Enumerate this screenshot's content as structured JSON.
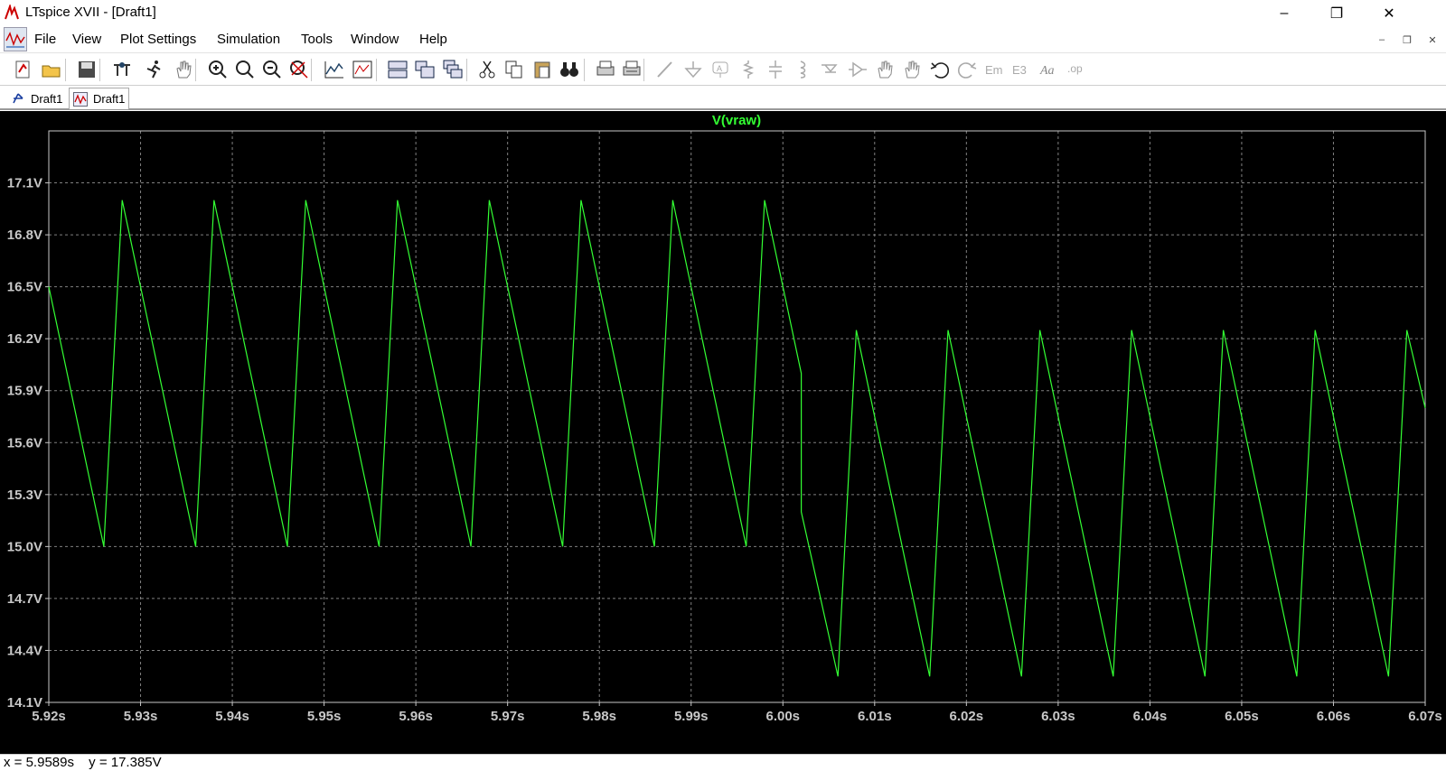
{
  "window": {
    "title": "LTspice XVII - [Draft1]",
    "minimize_glyph": "–",
    "maximize_glyph": "❐",
    "close_glyph": "✕"
  },
  "menu": {
    "items": [
      {
        "label": "File"
      },
      {
        "label": "View"
      },
      {
        "label": "Plot Settings"
      },
      {
        "label": "Simulation"
      },
      {
        "label": "Tools"
      },
      {
        "label": "Window"
      },
      {
        "label": "Help"
      }
    ],
    "mdi_minimize": "–",
    "mdi_restore": "❐",
    "mdi_close": "✕"
  },
  "toolbar": {
    "icons": [
      "new-schematic-icon",
      "open-icon",
      "save-icon",
      "control-panel-icon",
      "run-icon",
      "pan-hand-icon",
      "zoom-in-icon",
      "zoom-area-icon",
      "zoom-out-icon",
      "zoom-fit-icon",
      "autorange-icon",
      "annotate-icon",
      "tile-horizontal-icon",
      "tile-vertical-icon",
      "cascade-icon",
      "cut-icon",
      "copy-icon",
      "paste-icon",
      "find-icon",
      "print-icon",
      "print-setup-icon",
      "wire-icon",
      "ground-icon",
      "label-net-icon",
      "resistor-icon",
      "capacitor-icon",
      "inductor-icon",
      "diode-icon",
      "component-icon",
      "move-icon",
      "drag-icon",
      "undo-icon",
      "redo-icon",
      "rotate-icon",
      "mirror-icon",
      "text-icon",
      "spice-directive-icon"
    ]
  },
  "tabs": [
    {
      "label": "Draft1",
      "icon": "schematic-icon"
    },
    {
      "label": "Draft1",
      "icon": "waveform-icon",
      "active": true
    }
  ],
  "status": {
    "x_readout": "x = 5.9589s",
    "y_readout": "y = 17.385V"
  },
  "colors": {
    "trace": "#33ff33",
    "plot_background": "#000000",
    "grid": "#808080",
    "axis_text": "#c8c8c8"
  },
  "chart_data": {
    "type": "line",
    "title": "V(vraw)",
    "xlabel": "",
    "ylabel": "",
    "xlim": [
      5.92,
      6.07
    ],
    "ylim": [
      14.1,
      17.4
    ],
    "grid": true,
    "x_ticks": [
      "5.92s",
      "5.93s",
      "5.94s",
      "5.95s",
      "5.96s",
      "5.97s",
      "5.98s",
      "5.99s",
      "6.00s",
      "6.01s",
      "6.02s",
      "6.03s",
      "6.04s",
      "6.05s",
      "6.06s",
      "6.07s"
    ],
    "x_tick_values": [
      5.92,
      5.93,
      5.94,
      5.95,
      5.96,
      5.97,
      5.98,
      5.99,
      6.0,
      6.01,
      6.02,
      6.03,
      6.04,
      6.05,
      6.06,
      6.07
    ],
    "y_ticks": [
      "14.1V",
      "14.4V",
      "14.7V",
      "15.0V",
      "15.3V",
      "15.6V",
      "15.9V",
      "16.2V",
      "16.5V",
      "16.8V",
      "17.1V"
    ],
    "y_tick_values": [
      14.1,
      14.4,
      14.7,
      15.0,
      15.3,
      15.6,
      15.9,
      16.2,
      16.5,
      16.8,
      17.1
    ],
    "series": [
      {
        "name": "V(vraw)",
        "x": [
          5.92,
          5.926,
          5.928,
          5.936,
          5.938,
          5.946,
          5.948,
          5.956,
          5.958,
          5.966,
          5.968,
          5.976,
          5.978,
          5.986,
          5.988,
          5.996,
          5.998,
          6.002,
          6.002,
          6.006,
          6.008,
          6.016,
          6.018,
          6.026,
          6.028,
          6.036,
          6.038,
          6.046,
          6.048,
          6.056,
          6.058,
          6.066,
          6.068,
          6.07
        ],
        "y": [
          16.5,
          15.0,
          17.0,
          15.0,
          17.0,
          15.0,
          17.0,
          15.0,
          17.0,
          15.0,
          17.0,
          15.0,
          17.0,
          15.0,
          17.0,
          15.0,
          17.0,
          16.0,
          15.2,
          14.25,
          16.25,
          14.25,
          16.25,
          14.25,
          16.25,
          14.25,
          16.25,
          14.25,
          16.25,
          14.25,
          16.25,
          14.25,
          16.25,
          15.8
        ]
      }
    ]
  }
}
